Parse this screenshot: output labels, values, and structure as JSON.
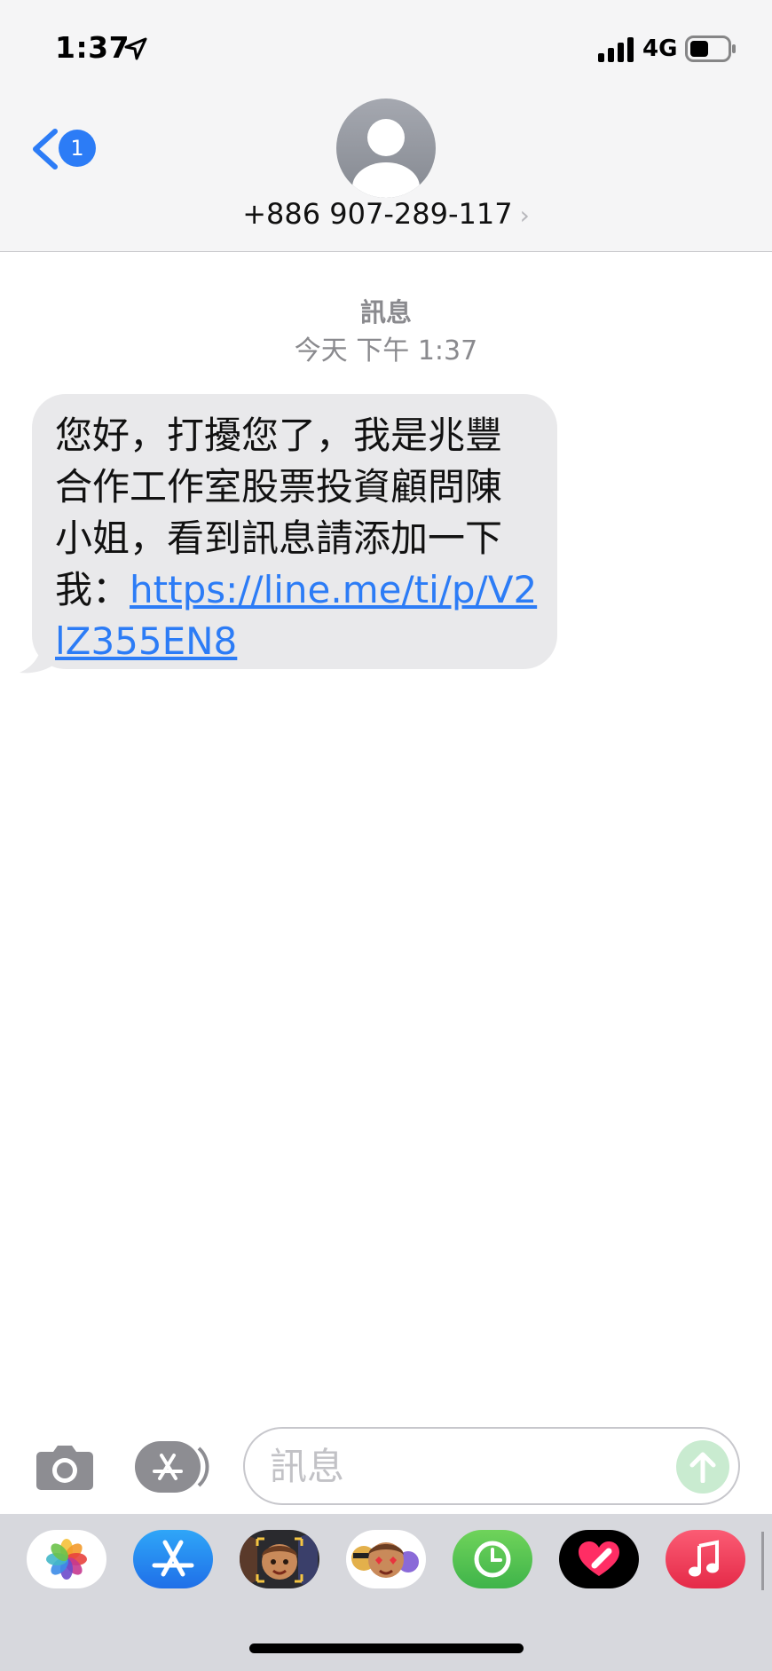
{
  "status_bar": {
    "time": "1:37",
    "network": "4G",
    "icons": [
      "location-arrow-icon",
      "signal-icon",
      "battery-icon"
    ]
  },
  "header": {
    "back_badge": "1",
    "contact_number": "+886 907-289-117",
    "chevron": "›"
  },
  "conversation": {
    "label": "訊息",
    "timestamp": "今天 下午 1:37",
    "message": {
      "text": "您好，打擾您了，我是兆豐合作工作室股票投資顧問陳小姐，看到訊息請添加一下我：",
      "link": "https://line.me/ti/p/V2lZ355EN8"
    }
  },
  "composer": {
    "placeholder": "訊息",
    "value": ""
  },
  "app_drawer": {
    "apps": [
      "photos-icon",
      "app-store-icon",
      "memoji-icon",
      "animoji-icon",
      "clock-icon",
      "digital-touch-icon",
      "music-icon"
    ]
  },
  "colors": {
    "accent": "#2c7cf6",
    "bubble_received": "#e9e9eb",
    "header_bg": "#f5f5f6",
    "drawer_bg": "#d7d8dd",
    "secondary_text": "#8a8a8e"
  }
}
